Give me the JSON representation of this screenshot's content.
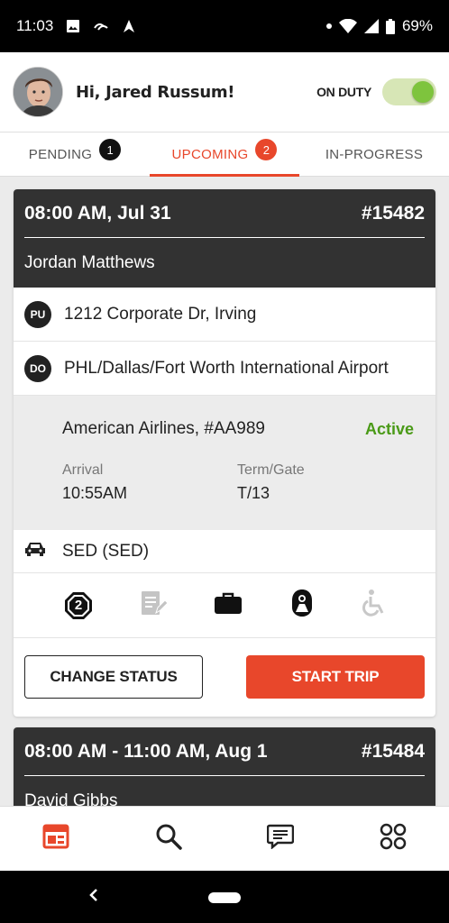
{
  "status_bar": {
    "time": "11:03",
    "battery": "69%"
  },
  "header": {
    "greeting": "Hi, Jared Russum!",
    "duty_label": "ON DUTY",
    "duty_on": true
  },
  "tabs": [
    {
      "label": "PENDING",
      "badge": "1"
    },
    {
      "label": "UPCOMING",
      "badge": "2",
      "active": true
    },
    {
      "label": "IN-PROGRESS"
    }
  ],
  "trip1": {
    "datetime": "08:00 AM, Jul 31",
    "number": "#15482",
    "passenger": "Jordan Matthews",
    "pickup_badge": "PU",
    "pickup": "1212 Corporate Dr, Irving",
    "dropoff_badge": "DO",
    "dropoff": "PHL/Dallas/Fort Worth International Airport",
    "flight": "American Airlines, #AA989",
    "flight_status": "Active",
    "arrival_label": "Arrival",
    "arrival": "10:55AM",
    "gate_label": "Term/Gate",
    "gate": "T/13",
    "vehicle": "SED (SED)",
    "passenger_count": "2",
    "change_status": "CHANGE STATUS",
    "start_trip": "START TRIP"
  },
  "trip2": {
    "datetime": "08:00 AM - 11:00 AM, Aug 1",
    "number": "#15484",
    "passenger": "David Gibbs"
  },
  "colors": {
    "accent": "#e8472b",
    "active_green": "#4a9a17",
    "card_header": "#323232"
  }
}
